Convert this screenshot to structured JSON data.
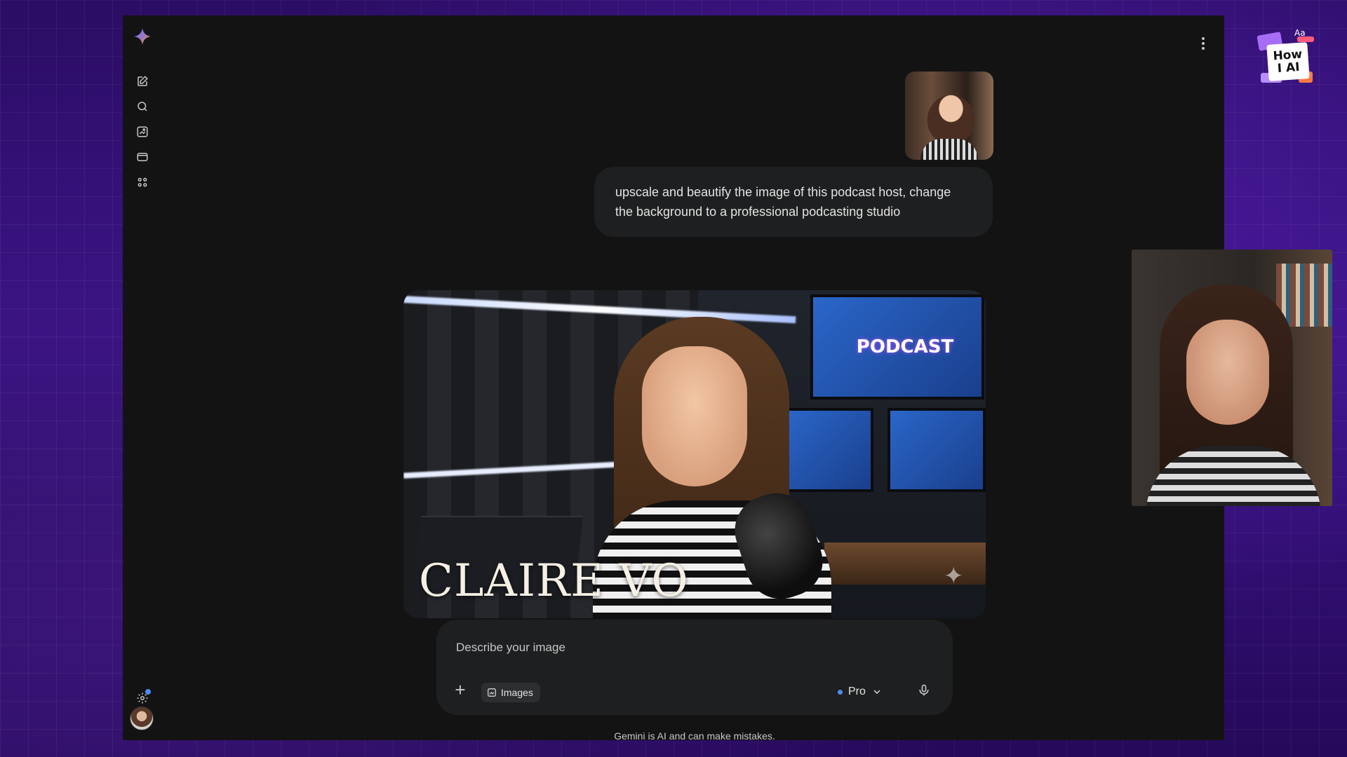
{
  "app": {
    "name": "Gemini"
  },
  "chat": {
    "user_prompt": "upscale and beautify the image of this podcast host, change the background to a professional podcasting studio",
    "generated_image": {
      "caption": "CLAIRE VO",
      "monitor_text": "PODCAST"
    }
  },
  "composer": {
    "placeholder": "Describe your image",
    "tool_chip": "Images",
    "model": "Pro"
  },
  "footer": {
    "disclaimer": "Gemini is AI and can make mistakes."
  },
  "overlay": {
    "badge_line1": "How",
    "badge_line2": "I AI",
    "badge_corner": "Aa"
  },
  "colors": {
    "accent": "#4c8df6",
    "app_bg": "#131314",
    "surface": "#1e1f20"
  }
}
